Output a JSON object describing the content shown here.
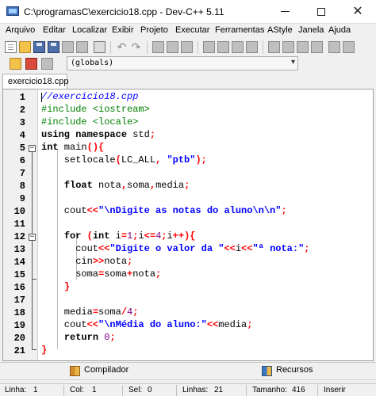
{
  "window": {
    "title": "C:\\programasC\\exercicio18.cpp - Dev-C++ 5.11",
    "min_icon": "minimize-icon",
    "max_icon": "maximize-icon",
    "close_glyph": "✕"
  },
  "menu": [
    "Arquivo",
    "Editar",
    "Localizar",
    "Exibir",
    "Projeto",
    "Executar",
    "Ferramentas",
    "AStyle",
    "Janela",
    "Ajuda"
  ],
  "toolbar": {
    "scope_value": "(globals)"
  },
  "tab": {
    "label": "exercicio18.cpp"
  },
  "editor": {
    "line_numbers": [
      "1",
      "2",
      "3",
      "4",
      "5",
      "6",
      "7",
      "8",
      "9",
      "10",
      "11",
      "12",
      "13",
      "14",
      "15",
      "16",
      "17",
      "18",
      "19",
      "20",
      "21"
    ],
    "current_line": 1
  },
  "bottom_tabs": {
    "compiler": "Compilador",
    "resources": "Recursos"
  },
  "status": {
    "line_label": "Linha:",
    "line_value": "1",
    "col_label": "Col:",
    "col_value": "1",
    "sel_label": "Sel:",
    "sel_value": "0",
    "lines_label": "Linhas:",
    "lines_value": "21",
    "size_label": "Tamanho:",
    "size_value": "416",
    "mode": "Inserir"
  },
  "colors": {
    "comment": "#0000ff",
    "preprocessor": "#008000",
    "string": "#0000ff",
    "number": "#800080",
    "symbol": "#ff0000"
  }
}
